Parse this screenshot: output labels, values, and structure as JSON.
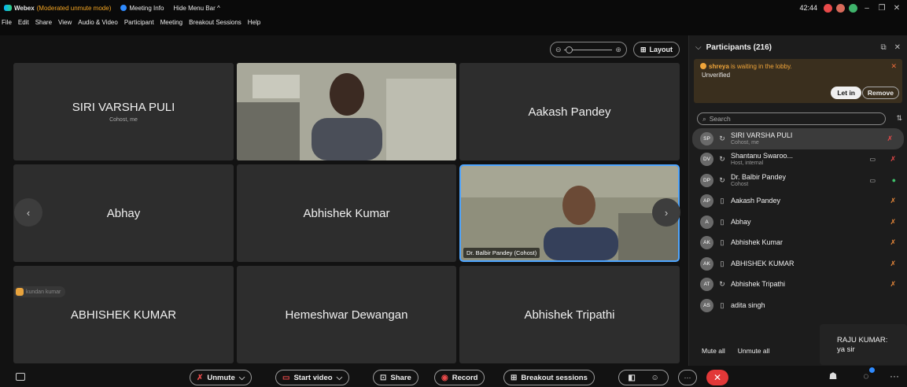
{
  "titlebar": {
    "app": "Webex",
    "mode": "(Moderated unmute mode)",
    "meeting_info": "Meeting Info",
    "hide_menu": "Hide Menu Bar ^",
    "time": "42:44",
    "minimize": "–",
    "restore": "❐",
    "close": "✕"
  },
  "menu": [
    "File",
    "Edit",
    "Share",
    "View",
    "Audio & Video",
    "Participant",
    "Meeting",
    "Breakout Sessions",
    "Help"
  ],
  "stage": {
    "zoom_minus": "⊖",
    "zoom_plus": "⊕",
    "layout_label": "Layout",
    "layout_icon": "⊞",
    "tiles": [
      {
        "name": "SIRI VARSHA PULI",
        "sub": "Cohost, me"
      },
      {
        "name": ""
      },
      {
        "name": "Aakash Pandey"
      },
      {
        "name": "Abhay"
      },
      {
        "name": "Abhishek Kumar"
      },
      {
        "name": "",
        "video_label": "Dr. Balbir Pandey (Cohost)"
      },
      {
        "name": "ABHISHEK KUMAR"
      },
      {
        "name": "Hemeshwar Dewangan"
      },
      {
        "name": "Abhishek Tripathi"
      }
    ],
    "prev_arrow": "‹",
    "next_arrow": "›",
    "reaction_name": "kundan kumar"
  },
  "toolbar": {
    "unmute": "Unmute",
    "start_video": "Start video",
    "share": "Share",
    "record": "Record",
    "breakout": "Breakout sessions",
    "chevron": "⌵",
    "more": "···",
    "leave": "✕"
  },
  "participants": {
    "title": "Participants (216)",
    "lobby_name": "shreya",
    "lobby_text": " is waiting in the lobby.",
    "lobby_status": "Unverified",
    "let_in": "Let in",
    "remove": "Remove",
    "search_placeholder": "Search",
    "rows": [
      {
        "initials": "SP",
        "name": "SIRI VARSHA PULI",
        "sub": "Cohost, me"
      },
      {
        "initials": "DV",
        "name": "Shantanu Swaroo...",
        "sub": "Host, internal"
      },
      {
        "initials": "DP",
        "name": "Dr. Balbir Pandey",
        "sub": "Cohost"
      },
      {
        "initials": "AP",
        "name": "Aakash Pandey"
      },
      {
        "initials": "A",
        "name": "Abhay"
      },
      {
        "initials": "AK",
        "name": "Abhishek Kumar"
      },
      {
        "initials": "AK",
        "name": "ABHISHEK KUMAR"
      },
      {
        "initials": "AT",
        "name": "Abhishek Tripathi"
      },
      {
        "initials": "AS",
        "name": "adita singh"
      }
    ],
    "mute_all": "Mute all",
    "unmute_all": "Unmute all"
  },
  "chat_popup": {
    "sender": "RAJU KUMAR:",
    "message": "ya sir"
  },
  "colors": {
    "accent": "#4ea5ff",
    "warning": "#f0a53a",
    "danger": "#e23838",
    "unmuted": "#3fc16b"
  }
}
